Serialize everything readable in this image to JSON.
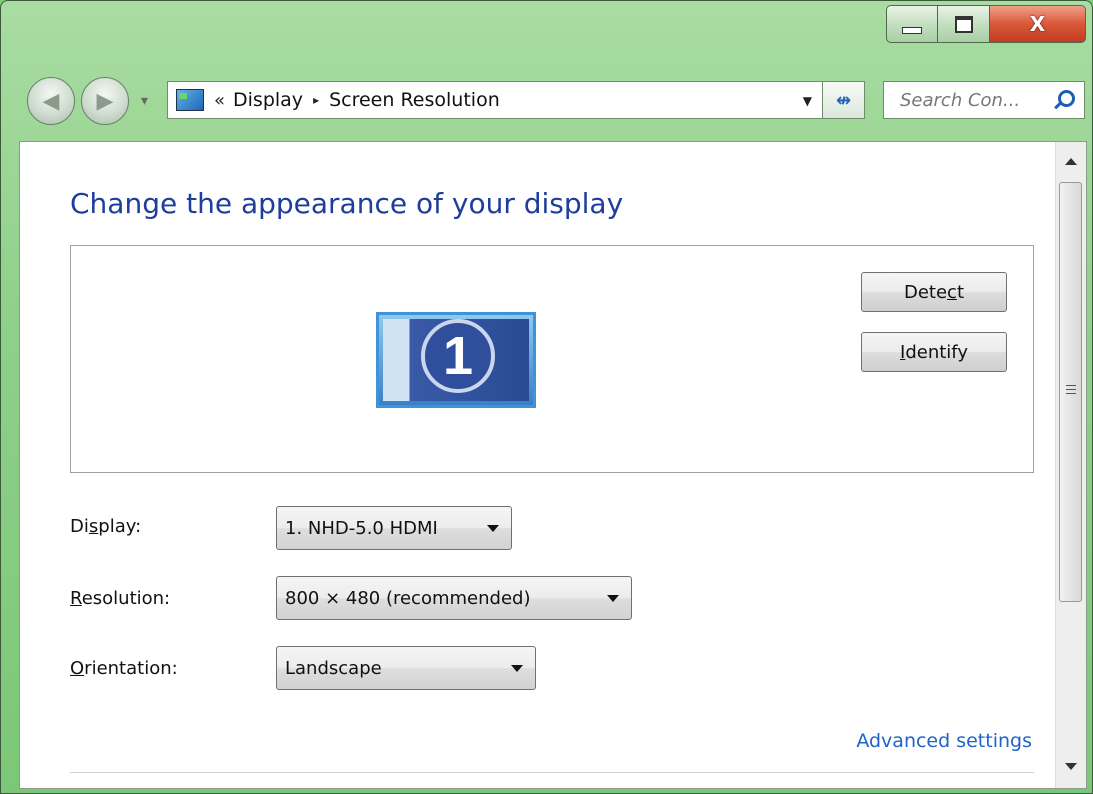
{
  "window": {
    "caption_buttons": {
      "minimize_icon": "minimize-icon",
      "maximize_icon": "maximize-icon",
      "close_glyph": "X"
    }
  },
  "navigation": {
    "back_icon": "back-arrow-icon",
    "forward_icon": "forward-arrow-icon",
    "address": {
      "separator": "«",
      "crumb1": "Display",
      "arrow": "▸",
      "crumb2": "Screen Resolution"
    },
    "refresh_glyph": "↮",
    "search": {
      "placeholder": "Search Con..."
    }
  },
  "main": {
    "title": "Change the appearance of your display",
    "monitor": {
      "number": "1"
    },
    "buttons": {
      "detect": {
        "pre": "Dete",
        "accel": "c",
        "post": "t"
      },
      "identify": {
        "accel": "I",
        "post": "dentify"
      }
    },
    "fields": [
      {
        "label_pre": "Di",
        "label_accel": "s",
        "label_post": "play:",
        "value": "1. NHD-5.0 HDMI"
      },
      {
        "label_pre": "",
        "label_accel": "R",
        "label_post": "esolution:",
        "value": "800 × 480 (recommended)"
      },
      {
        "label_pre": "",
        "label_accel": "O",
        "label_post": "rientation:",
        "value": "Landscape"
      }
    ],
    "advanced_link": "Advanced settings"
  },
  "colors": {
    "title": "#1e3e9b",
    "link": "#1e64c8",
    "chrome": "#8fd08a"
  }
}
